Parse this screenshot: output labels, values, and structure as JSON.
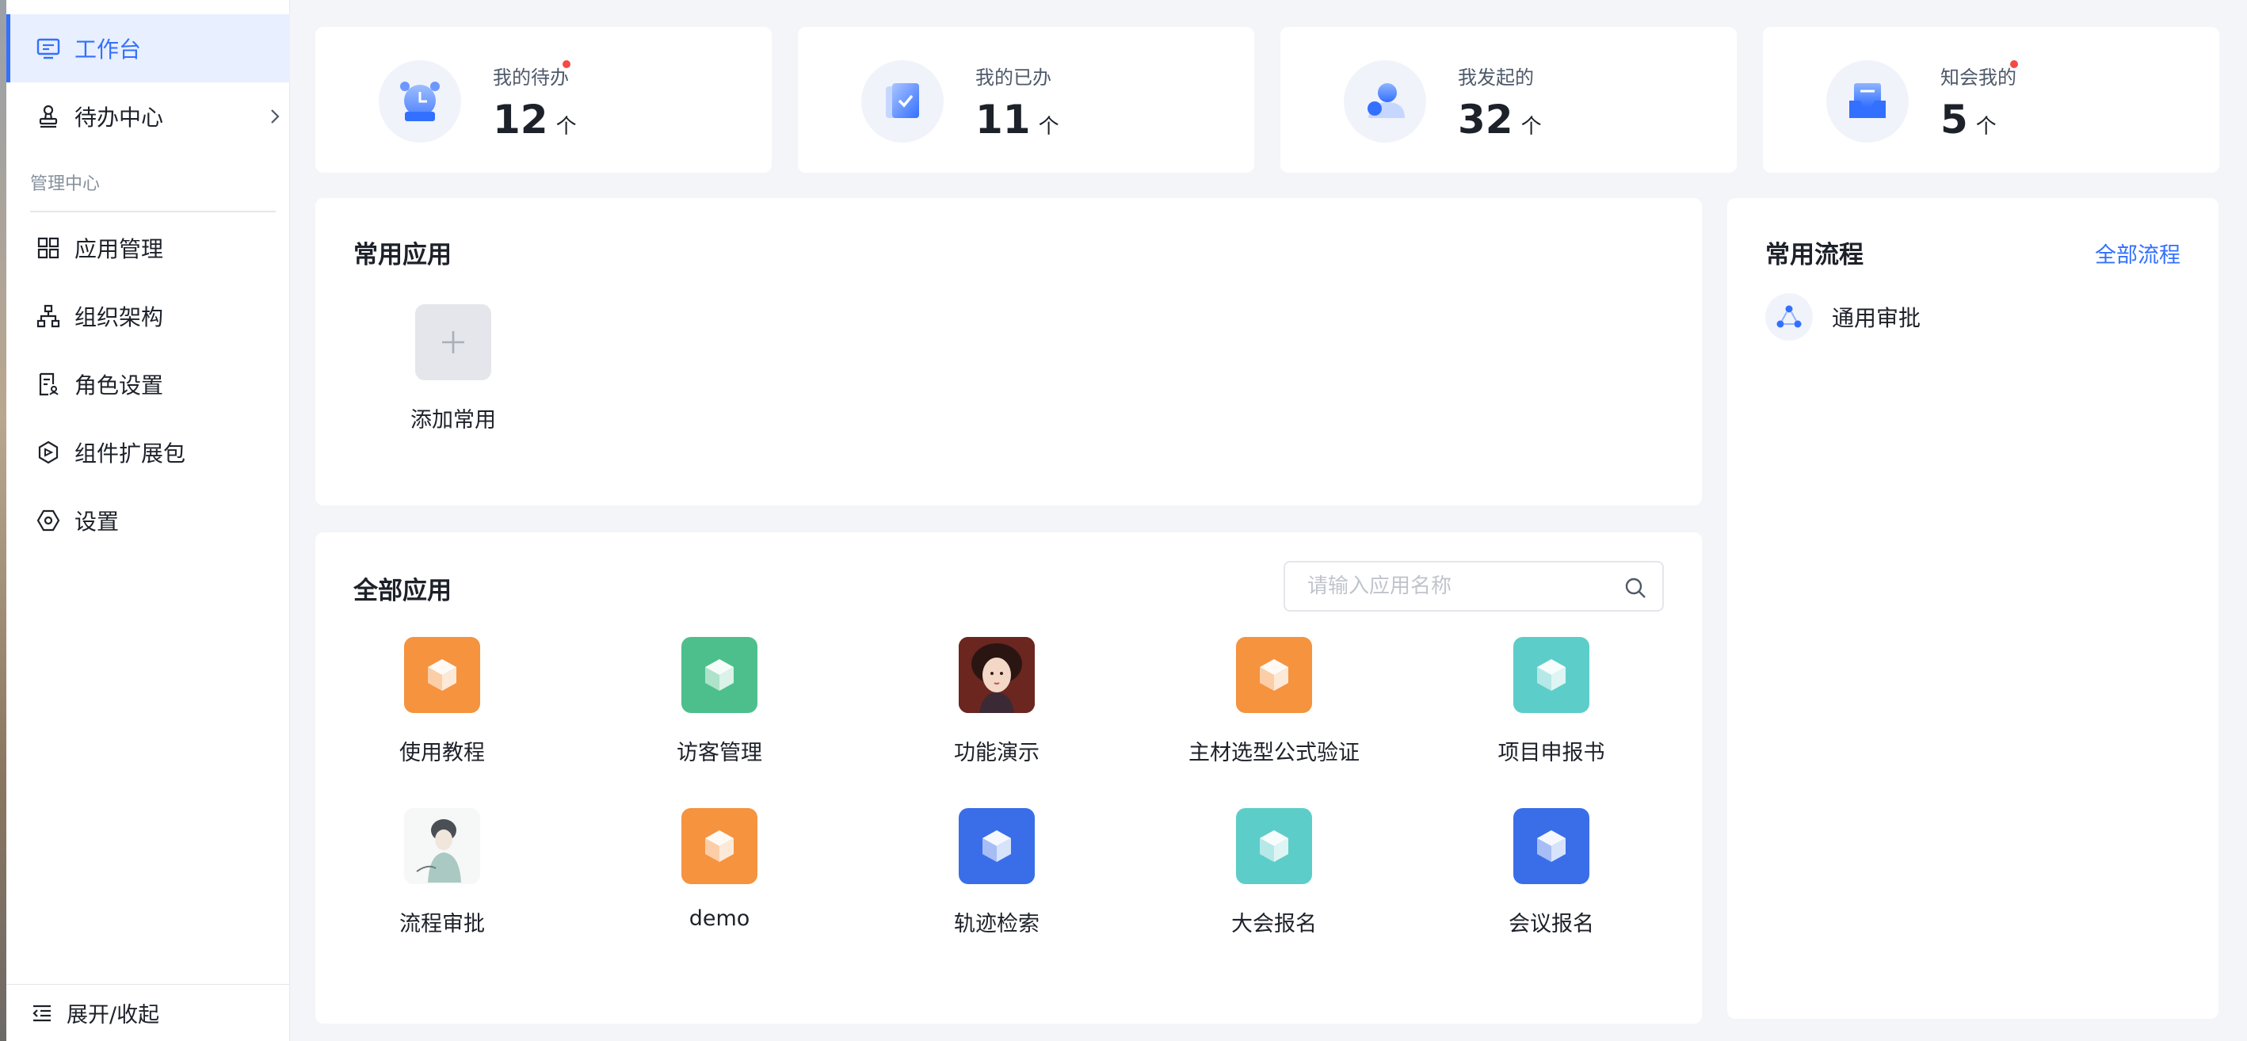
{
  "sidebar": {
    "items": [
      {
        "label": "工作台",
        "icon": "monitor-icon",
        "active": true
      },
      {
        "label": "待办中心",
        "icon": "stamp-icon",
        "has_arrow": true
      },
      {
        "label": "应用管理",
        "icon": "grid-icon"
      },
      {
        "label": "组织架构",
        "icon": "org-chart-icon"
      },
      {
        "label": "角色设置",
        "icon": "role-doc-icon"
      },
      {
        "label": "组件扩展包",
        "icon": "plugin-icon"
      },
      {
        "label": "设置",
        "icon": "settings-icon"
      }
    ],
    "section_label": "管理中心",
    "footer_label": "展开/收起"
  },
  "stats": [
    {
      "label": "我的待办",
      "value": "12",
      "unit": "个",
      "badge": true,
      "icon": "alarm-clock-icon"
    },
    {
      "label": "我的已办",
      "value": "11",
      "unit": "个",
      "badge": false,
      "icon": "clipboard-check-icon"
    },
    {
      "label": "我发起的",
      "value": "32",
      "unit": "个",
      "badge": false,
      "icon": "user-icon"
    },
    {
      "label": "知会我的",
      "value": "5",
      "unit": "个",
      "badge": true,
      "icon": "inbox-icon"
    }
  ],
  "common_apps": {
    "title": "常用应用",
    "add_label": "添加常用"
  },
  "all_apps": {
    "title": "全部应用",
    "search_placeholder": "请输入应用名称",
    "apps": [
      {
        "label": "使用教程",
        "kind": "cube",
        "color": "#f5933f"
      },
      {
        "label": "访客管理",
        "kind": "cube",
        "color": "#4dbf8c"
      },
      {
        "label": "功能演示",
        "kind": "portrait",
        "color": "#7a2b22"
      },
      {
        "label": "主材选型公式验证",
        "kind": "cube",
        "color": "#f5933f"
      },
      {
        "label": "项目申报书",
        "kind": "cube",
        "color": "#5dcdc9"
      },
      {
        "label": "流程审批",
        "kind": "sketch",
        "color": "#eef1f1"
      },
      {
        "label": "demo",
        "kind": "cube",
        "color": "#f5933f"
      },
      {
        "label": "轨迹检索",
        "kind": "cube",
        "color": "#3a6ee8"
      },
      {
        "label": "大会报名",
        "kind": "cube",
        "color": "#5dcdc9"
      },
      {
        "label": "会议报名",
        "kind": "cube",
        "color": "#3a6ee8"
      }
    ]
  },
  "flows": {
    "title": "常用流程",
    "all_link": "全部流程",
    "items": [
      {
        "label": "通用审批",
        "icon": "workflow-icon"
      }
    ]
  },
  "colors": {
    "accent": "#3370ff",
    "badge": "#f54a45"
  }
}
